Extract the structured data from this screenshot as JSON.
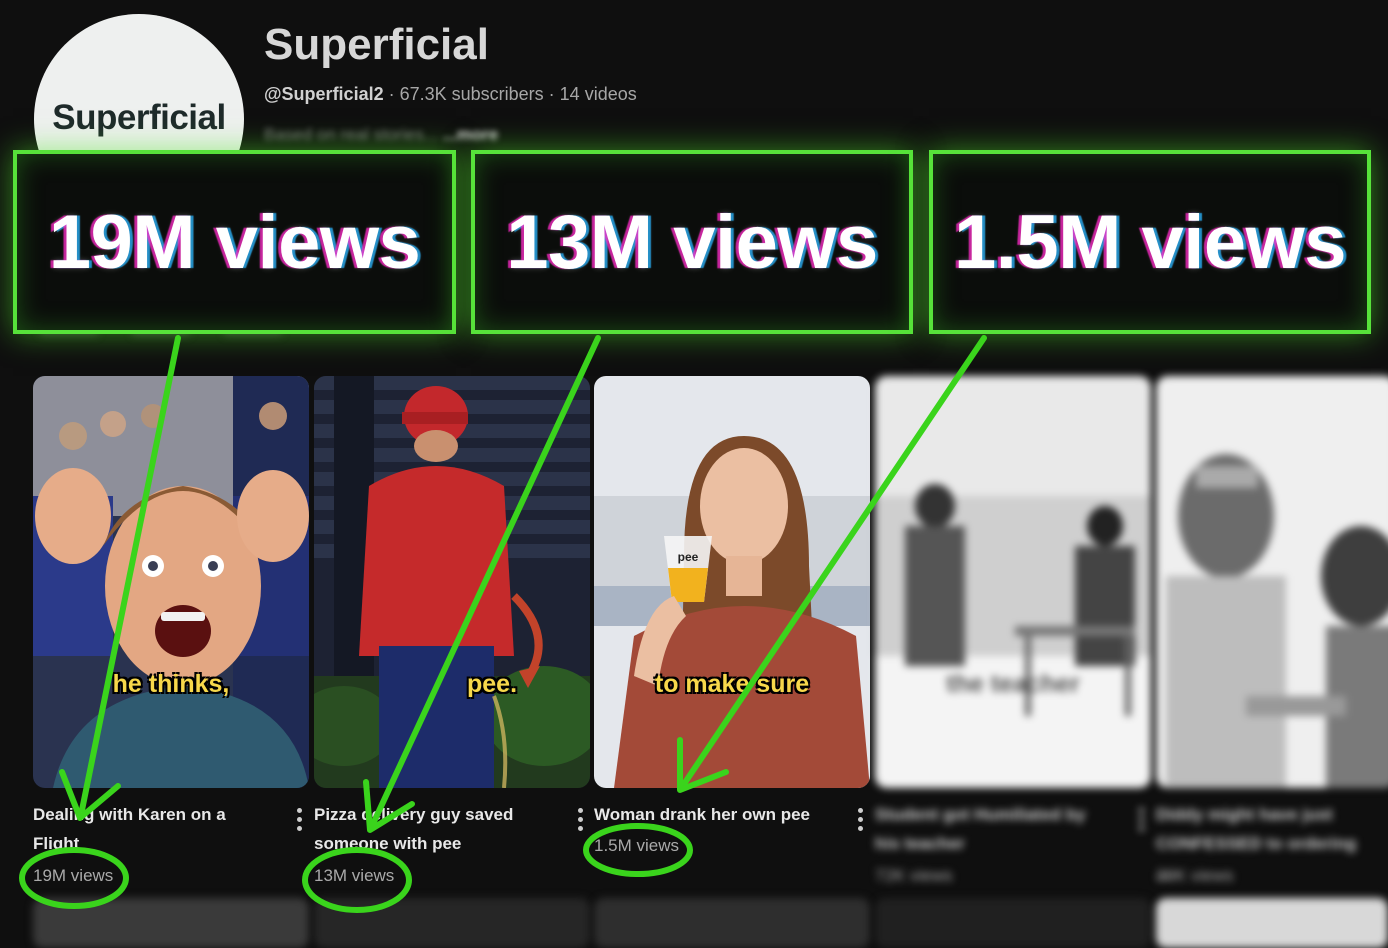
{
  "channel": {
    "avatar_text": "Superficial",
    "name": "Superficial",
    "handle": "@Superficial2",
    "subscribers": "67.3K subscribers",
    "videos": "14 videos",
    "separator": " · ",
    "description": "Based on real stories...",
    "more": "...more"
  },
  "callouts": [
    "19M views",
    "13M views",
    "1.5M views"
  ],
  "videos": [
    {
      "title": "Dealing with Karen on a Flight",
      "views": "19M views",
      "caption": "he thinks,",
      "icon": "kebab-menu-icon"
    },
    {
      "title": "Pizza delivery guy saved someone with pee",
      "views": "13M views",
      "caption": "pee.",
      "icon": "kebab-menu-icon"
    },
    {
      "title": "Woman drank her own pee",
      "views": "1.5M views",
      "caption": "to make sure",
      "cup_label": "pee",
      "icon": "kebab-menu-icon"
    },
    {
      "title": "Student got Humiliated by his teacher",
      "views": "72K views",
      "caption": "the teacher",
      "icon": "kebab-menu-icon"
    },
    {
      "title": "Diddy might have just CONFESSED to ordering ...",
      "views": "39K views",
      "icon": "kebab-menu-icon"
    }
  ],
  "colors": {
    "background": "#0f0f0f",
    "highlight_green": "#57e23a",
    "caption_yellow": "#f7d84b"
  }
}
